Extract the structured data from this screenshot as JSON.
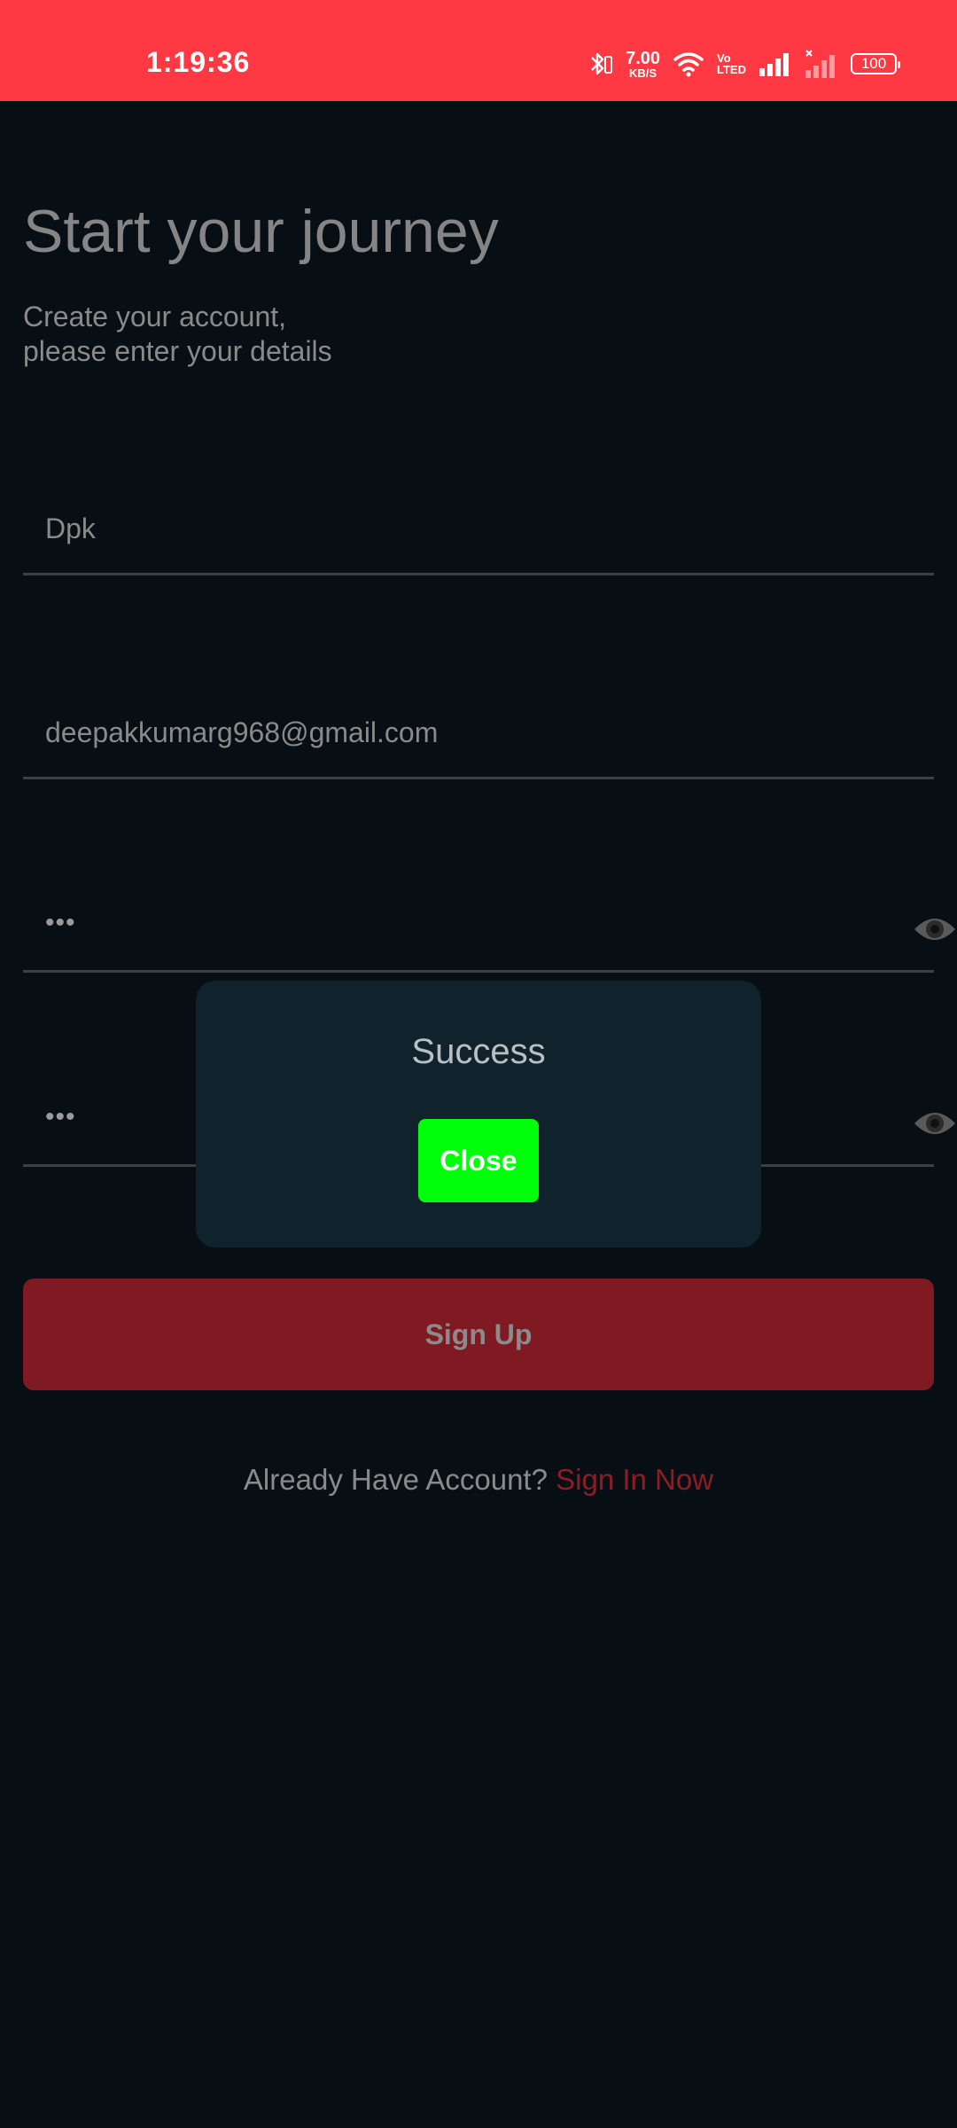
{
  "status_bar": {
    "time": "1:19:36",
    "net_speed_value": "7.00",
    "net_speed_unit": "KB/S",
    "volte_top": "Vo",
    "volte_bottom": "LTED",
    "battery": "100",
    "background": "#ff3944"
  },
  "header": {
    "title": "Start your journey",
    "subtitle_line1": "Create your account,",
    "subtitle_line2": "please enter your details"
  },
  "form": {
    "name_value": "Dpk",
    "email_value": "deepakkumarg968@gmail.com",
    "password_value": "•••",
    "confirm_password_value": "•••",
    "signup_label": "Sign Up"
  },
  "footer": {
    "prompt": "Already Have Account?",
    "link": "Sign In Now"
  },
  "dialog": {
    "title": "Success",
    "close_label": "Close"
  },
  "colors": {
    "background": "#070f14",
    "accent": "#ff3944",
    "signup_button": "#7f1a23",
    "dialog_background": "#10222c",
    "close_button": "#00ff0a"
  }
}
